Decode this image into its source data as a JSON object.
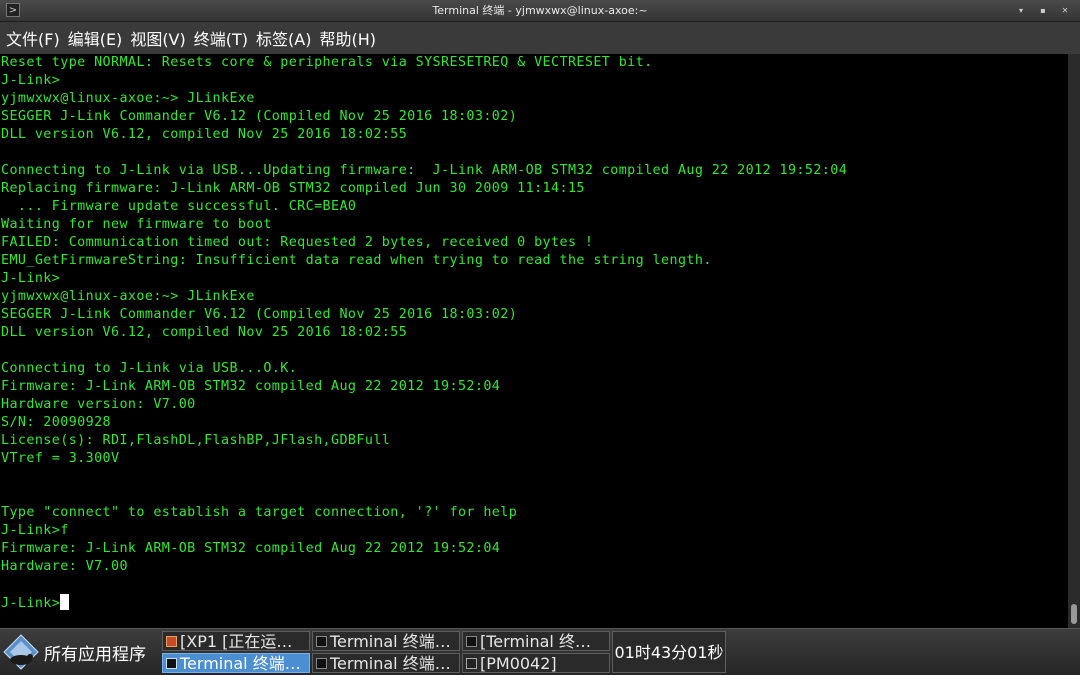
{
  "window": {
    "title": "Terminal 终端 - yjmwxwx@linux-axoe:~",
    "controls": [
      {
        "name": "minimize-button",
        "glyph": "▾"
      },
      {
        "name": "maximize-button",
        "glyph": "▪"
      },
      {
        "name": "close-button",
        "glyph": "✕"
      }
    ]
  },
  "menu": [
    "文件(F)",
    "编辑(E)",
    "视图(V)",
    "终端(T)",
    "标签(A)",
    "帮助(H)"
  ],
  "terminal": {
    "lines": [
      "Reset type NORMAL: Resets core & peripherals via SYSRESETREQ & VECTRESET bit.",
      "J-Link>",
      "yjmwxwx@linux-axoe:~> JLinkExe",
      "SEGGER J-Link Commander V6.12 (Compiled Nov 25 2016 18:03:02)",
      "DLL version V6.12, compiled Nov 25 2016 18:02:55",
      "",
      "Connecting to J-Link via USB...Updating firmware:  J-Link ARM-OB STM32 compiled Aug 22 2012 19:52:04",
      "Replacing firmware: J-Link ARM-OB STM32 compiled Jun 30 2009 11:14:15",
      "  ... Firmware update successful. CRC=BEA0",
      "Waiting for new firmware to boot",
      "FAILED: Communication timed out: Requested 2 bytes, received 0 bytes !",
      "EMU_GetFirmwareString: Insufficient data read when trying to read the string length.",
      "J-Link>",
      "yjmwxwx@linux-axoe:~> JLinkExe",
      "SEGGER J-Link Commander V6.12 (Compiled Nov 25 2016 18:03:02)",
      "DLL version V6.12, compiled Nov 25 2016 18:02:55",
      "",
      "Connecting to J-Link via USB...O.K.",
      "Firmware: J-Link ARM-OB STM32 compiled Aug 22 2012 19:52:04",
      "Hardware version: V7.00",
      "S/N: 20090928",
      "License(s): RDI,FlashDL,FlashBP,JFlash,GDBFull",
      "VTref = 3.300V",
      "",
      "",
      "Type \"connect\" to establish a target connection, '?' for help",
      "J-Link>f",
      "Firmware: J-Link ARM-OB STM32 compiled Aug 22 2012 19:52:04",
      "Hardware: V7.00",
      ""
    ],
    "prompt": "J-Link>",
    "text_color": "#2fe82f",
    "background": "#000000"
  },
  "taskbar": {
    "start_label": "所有应用程序",
    "tasks": [
      {
        "label": "[XP1 [正在运…",
        "icon": "vm-icon",
        "active": false
      },
      {
        "label": "Terminal 终端…",
        "icon": "terminal-icon",
        "active": false
      },
      {
        "label": "[Terminal 终…",
        "icon": "terminal-icon",
        "active": false
      },
      {
        "label": "Terminal 终端…",
        "icon": "terminal-icon",
        "active": true
      },
      {
        "label": "Terminal 终端…",
        "icon": "terminal-icon",
        "active": false
      },
      {
        "label": "[PM0042]",
        "icon": "document-icon",
        "active": false
      }
    ],
    "clock": "01时43分01秒",
    "accent": "#4b8ed1"
  }
}
